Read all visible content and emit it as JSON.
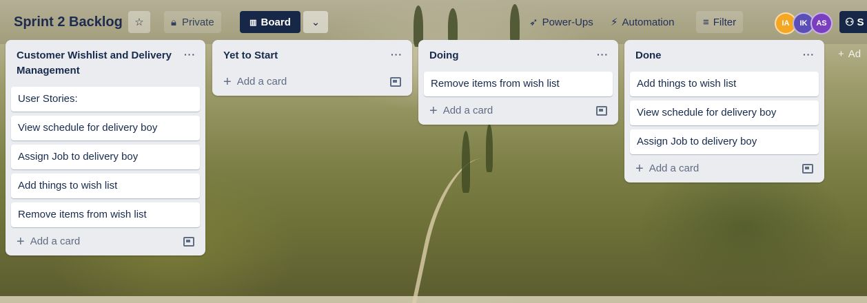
{
  "board": {
    "title": "Sprint 2 Backlog",
    "visibility": "Private",
    "view_label": "Board",
    "powerups_label": "Power-Ups",
    "automation_label": "Automation",
    "filter_label": "Filter",
    "share_label": "S",
    "add_list_label": "Ad",
    "avatars": [
      {
        "initials": "IA",
        "color": "#f5a623"
      },
      {
        "initials": "IK",
        "color": "#5b4fb7"
      },
      {
        "initials": "AS",
        "color": "#7a3fbf"
      }
    ]
  },
  "lists": [
    {
      "title": "Customer Wishlist and Delivery Management",
      "menu": "···",
      "cards": [
        "User Stories:",
        "View schedule for delivery boy",
        "Assign Job to delivery boy",
        "Add things to wish list",
        "Remove items from wish list"
      ],
      "add_label": "Add a card"
    },
    {
      "title": "Yet to Start",
      "menu": "···",
      "cards": [],
      "add_label": "Add a card"
    },
    {
      "title": "Doing",
      "menu": "···",
      "cards": [
        "Remove items from wish list"
      ],
      "add_label": "Add a card"
    },
    {
      "title": "Done",
      "menu": "···",
      "cards": [
        "Add things to wish list",
        "View schedule for delivery boy",
        "Assign Job to delivery boy"
      ],
      "add_label": "Add a card"
    }
  ]
}
